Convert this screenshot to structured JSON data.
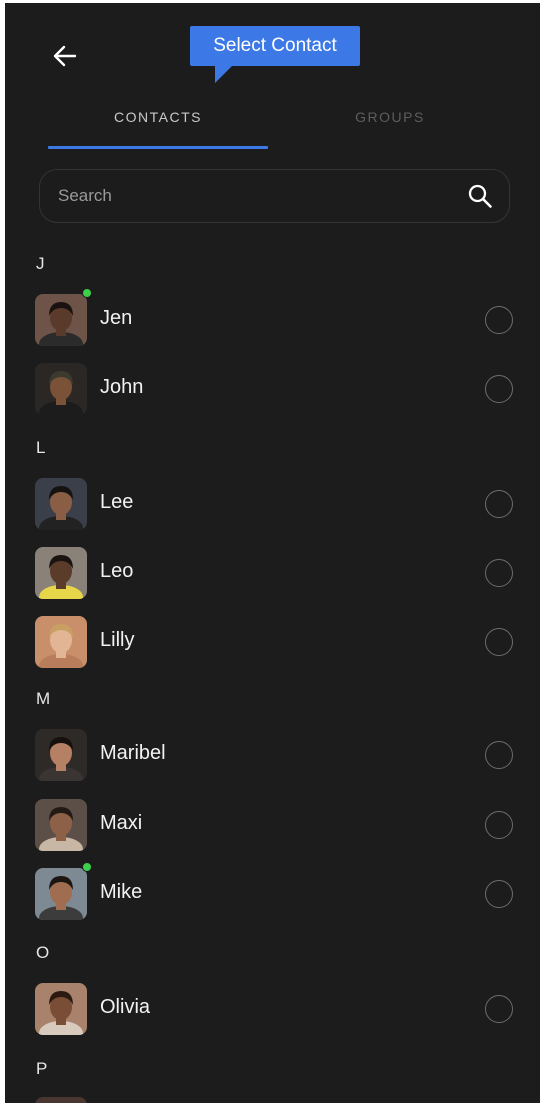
{
  "tooltip": {
    "text": "Select Contact",
    "color": "#3d79e6"
  },
  "header": {
    "back_icon": "arrow-left-icon"
  },
  "tabs": [
    {
      "label": "CONTACTS",
      "active": true
    },
    {
      "label": "GROUPS",
      "active": false
    }
  ],
  "search": {
    "placeholder": "Search",
    "value": "",
    "icon": "search-icon"
  },
  "sections": [
    {
      "letter": "J",
      "contacts": [
        {
          "name": "Jen",
          "online": true,
          "avatar": {
            "bg": "#6e5448",
            "skin": "#5a3a2a",
            "hair": "#1a1210",
            "shirt": "#2b2b2b"
          }
        },
        {
          "name": "John",
          "online": false,
          "avatar": {
            "bg": "#2b2724",
            "skin": "#7a5238",
            "hair": "#3b3a2e",
            "shirt": "#1c1c1c"
          }
        }
      ]
    },
    {
      "letter": "L",
      "contacts": [
        {
          "name": "Lee",
          "online": false,
          "avatar": {
            "bg": "#3a3f4a",
            "skin": "#8a5e44",
            "hair": "#15120f",
            "shirt": "#222222"
          }
        },
        {
          "name": "Leo",
          "online": false,
          "avatar": {
            "bg": "#8a8278",
            "skin": "#5b3b2a",
            "hair": "#1a1411",
            "shirt": "#e8d64a"
          }
        },
        {
          "name": "Lilly",
          "online": false,
          "avatar": {
            "bg": "#c98e6a",
            "skin": "#e2b595",
            "hair": "#c9a063",
            "shirt": "#b87d5a"
          }
        }
      ]
    },
    {
      "letter": "M",
      "contacts": [
        {
          "name": "Maribel",
          "online": false,
          "avatar": {
            "bg": "#2d2a28",
            "skin": "#b58064",
            "hair": "#17110e",
            "shirt": "#3a3532"
          }
        },
        {
          "name": "Maxi",
          "online": false,
          "avatar": {
            "bg": "#5c4f47",
            "skin": "#8d6048",
            "hair": "#241a15",
            "shirt": "#c9b7a5"
          }
        },
        {
          "name": "Mike",
          "online": true,
          "avatar": {
            "bg": "#7d8a93",
            "skin": "#a06d50",
            "hair": "#1c1512",
            "shirt": "#3c3c3c"
          }
        }
      ]
    },
    {
      "letter": "O",
      "contacts": [
        {
          "name": "Olivia",
          "online": false,
          "avatar": {
            "bg": "#a8826a",
            "skin": "#7a4e36",
            "hair": "#2a1a12",
            "shirt": "#d8cbbd"
          }
        }
      ]
    },
    {
      "letter": "P",
      "contacts": []
    }
  ]
}
